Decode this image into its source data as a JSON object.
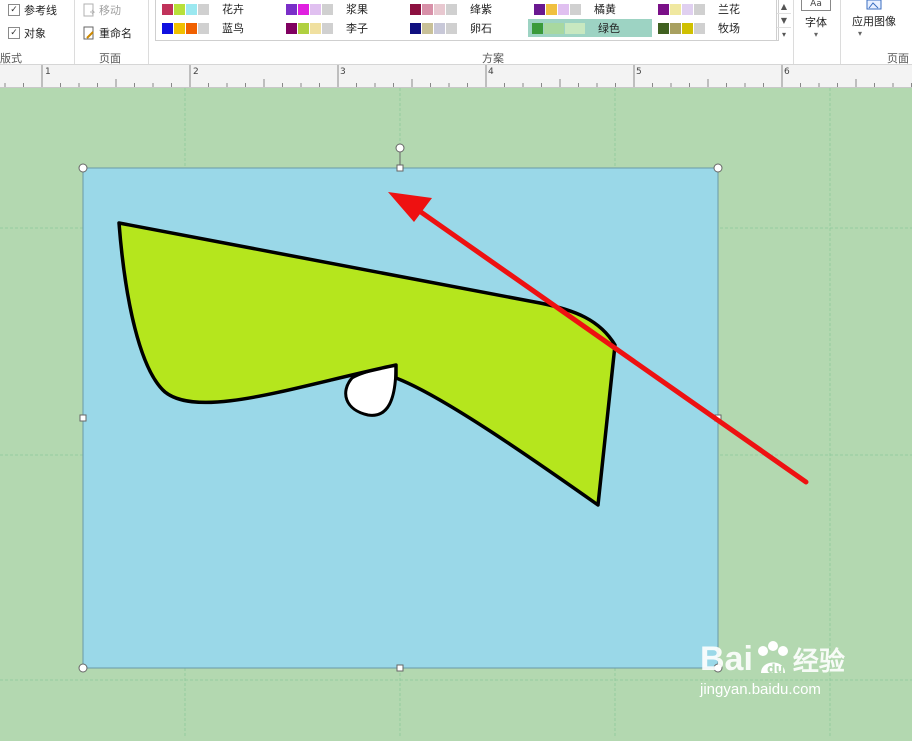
{
  "ribbon": {
    "show": {
      "guides_label": "参考线",
      "objects_label": "对象",
      "group_label": "版式"
    },
    "page": {
      "move_label": "移动",
      "rename_label": "重命名",
      "group_label": "页面"
    },
    "schemes": {
      "group_label": "方案",
      "items": [
        {
          "name": "花卉",
          "colors": [
            "#c0325a",
            "#b8e03a",
            "#9be8f0",
            "#d0d0d0"
          ]
        },
        {
          "name": "浆果",
          "colors": [
            "#7a2fc8",
            "#e020e0",
            "#e0c0f0",
            "#d0d0d0"
          ]
        },
        {
          "name": "绛紫",
          "colors": [
            "#8c1040",
            "#d890a8",
            "#e8c8d0",
            "#d0d0d0"
          ]
        },
        {
          "name": "橘黄",
          "colors": [
            "#6a1890",
            "#f0c040",
            "#e0c0f0",
            "#d0d0d0"
          ]
        },
        {
          "name": "兰花",
          "colors": [
            "#7a1088",
            "#f0e8a0",
            "#e0d0f0",
            "#d0d0d0"
          ]
        },
        {
          "name": "蓝鸟",
          "colors": [
            "#1010e0",
            "#f0c000",
            "#f06000",
            "#d0d0d0"
          ]
        },
        {
          "name": "李子",
          "colors": [
            "#800060",
            "#b0d040",
            "#f0e0a0",
            "#d0d0d0"
          ]
        },
        {
          "name": "卵石",
          "colors": [
            "#101080",
            "#c8c098",
            "#c8c8d8",
            "#d0d0d0"
          ]
        },
        {
          "name": "绿色",
          "colors": [
            "#3a9a3a",
            "#a8d8a0",
            "#c8e8c0",
            "#c8e8c0"
          ],
          "selected": true
        },
        {
          "name": "牧场",
          "colors": [
            "#406020",
            "#a8a060",
            "#d0c000",
            "#d0d0d0"
          ]
        }
      ]
    },
    "font_label": "字体",
    "apply_image_label": "应用图像",
    "page_group_label": "页面"
  },
  "ruler": {
    "numbers": [
      "1",
      "2",
      "3",
      "4",
      "5",
      "6"
    ]
  },
  "colors": {
    "background": "#b3d8b0",
    "page": "#9ad8e8",
    "shape_fill": "#b5e61d",
    "arrow": "#ee1111"
  },
  "watermark": {
    "brand": "Bai",
    "brand_tail": "经验",
    "url": "jingyan.baidu.com"
  }
}
